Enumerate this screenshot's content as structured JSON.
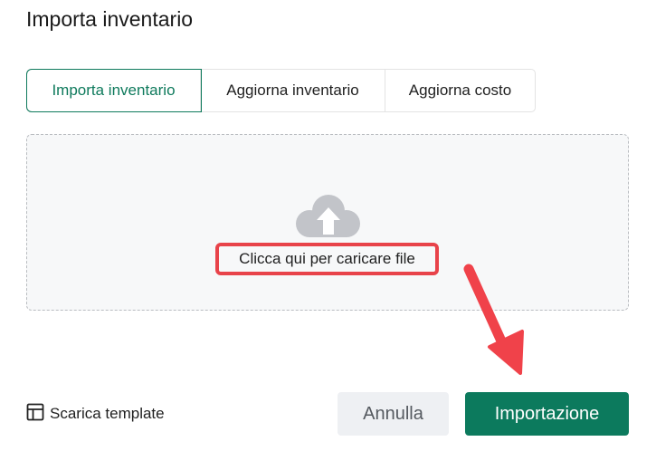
{
  "dialog": {
    "title": "Importa inventario"
  },
  "tabs": [
    {
      "label": "Importa inventario",
      "active": true
    },
    {
      "label": "Aggiorna inventario",
      "active": false
    },
    {
      "label": "Aggiorna costo",
      "active": false
    }
  ],
  "dropzone": {
    "icon": "cloud-upload-icon",
    "label": "Clicca qui per caricare file"
  },
  "footer": {
    "template_icon": "template-layout-icon",
    "template_label": "Scarica template",
    "cancel_label": "Annulla",
    "import_label": "Importazione"
  },
  "annotation": {
    "icon": "arrow-pointer-icon"
  },
  "colors": {
    "accent": "#0c7a5d",
    "highlight": "#e8434a",
    "dropzone_bg": "#f7f8f9",
    "cancel_bg": "#eef0f3"
  }
}
